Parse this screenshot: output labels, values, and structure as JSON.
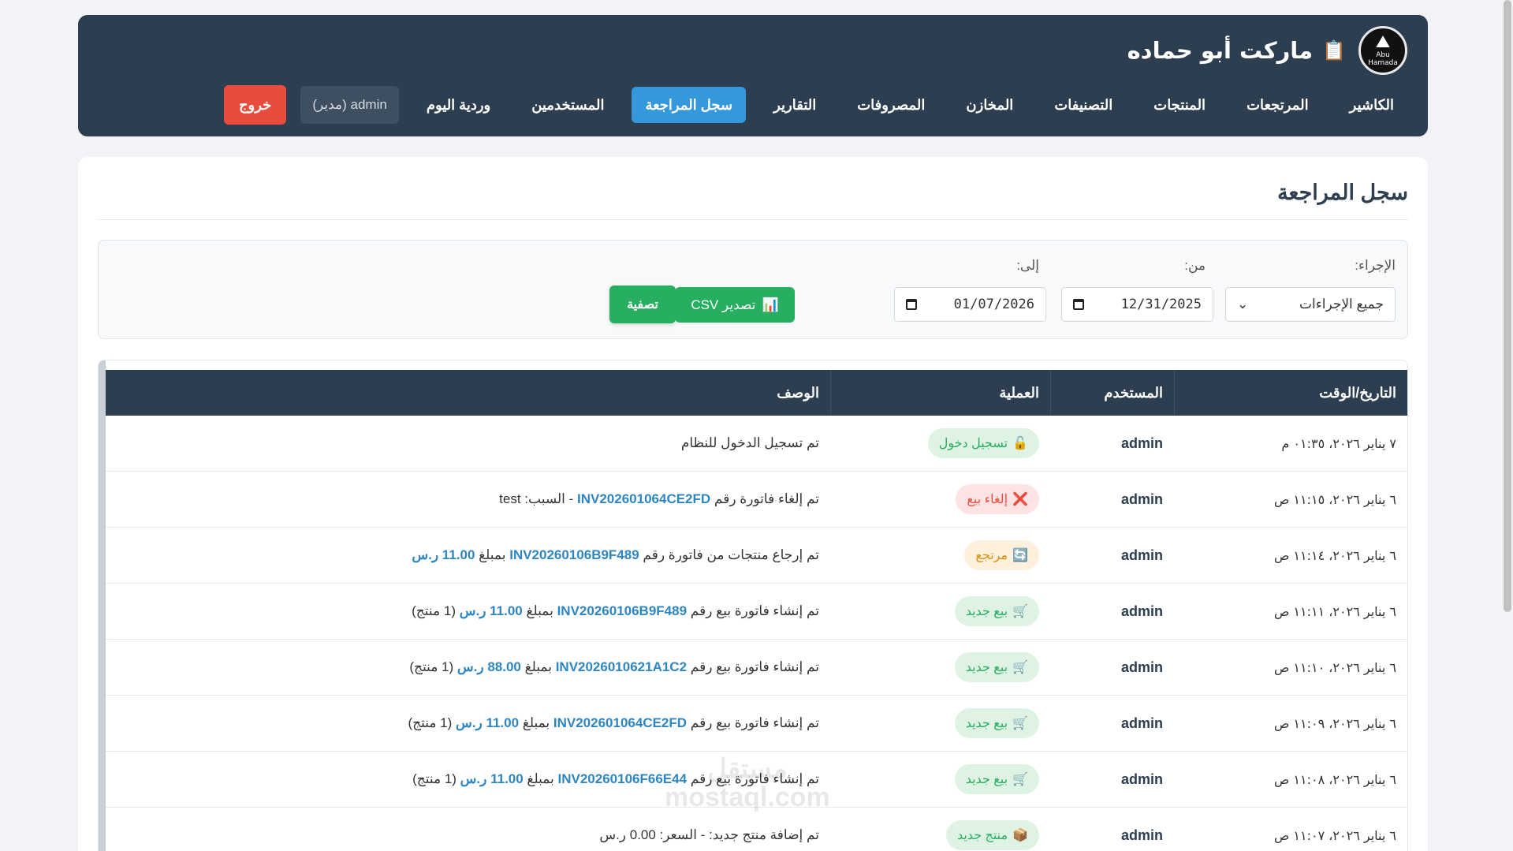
{
  "app": {
    "title": "ماركت أبو حماده",
    "logo_text": "Abu Hamada"
  },
  "nav": {
    "items": [
      {
        "label": "الكاشير"
      },
      {
        "label": "المرتجعات"
      },
      {
        "label": "المنتجات"
      },
      {
        "label": "التصنيفات"
      },
      {
        "label": "المخازن"
      },
      {
        "label": "المصروفات"
      },
      {
        "label": "التقارير"
      },
      {
        "label": "سجل المراجعة",
        "active": true
      },
      {
        "label": "المستخدمين"
      },
      {
        "label": "وردية اليوم"
      }
    ],
    "user_label": "admin (مدير)",
    "logout_label": "خروج"
  },
  "page": {
    "title": "سجل المراجعة"
  },
  "filters": {
    "action_label": "الإجراء:",
    "action_value": "جميع الإجراءات",
    "from_label": "من:",
    "from_value": "12/31/2025",
    "to_label": "إلى:",
    "to_value": "01/07/2026",
    "filter_button": "تصفية",
    "export_button": "تصدير CSV"
  },
  "table": {
    "headers": [
      "التاريخ/الوقت",
      "المستخدم",
      "العملية",
      "الوصف"
    ],
    "rows": [
      {
        "datetime": "٧ يناير ٢٠٢٦، ٠١:٣٥ م",
        "user": "admin",
        "action": "تسجيل دخول",
        "action_icon": "🔓",
        "type": "login",
        "desc": [
          {
            "t": "تم تسجيل الدخول للنظام"
          }
        ]
      },
      {
        "datetime": "٦ يناير ٢٠٢٦، ١١:١٥ ص",
        "user": "admin",
        "action": "إلغاء بيع",
        "action_icon": "❌",
        "type": "cancel",
        "desc": [
          {
            "t": "تم إلغاء فاتورة رقم "
          },
          {
            "t": "INV202601064CE2FD",
            "hl": true
          },
          {
            "t": " - السبب: test"
          }
        ]
      },
      {
        "datetime": "٦ يناير ٢٠٢٦، ١١:١٤ ص",
        "user": "admin",
        "action": "مرتجع",
        "action_icon": "🔄",
        "type": "return",
        "desc": [
          {
            "t": "تم إرجاع منتجات من فاتورة رقم "
          },
          {
            "t": "INV20260106B9F489",
            "hl": true
          },
          {
            "t": " بمبلغ "
          },
          {
            "t": "11.00 ر.س",
            "hl": true
          }
        ]
      },
      {
        "datetime": "٦ يناير ٢٠٢٦، ١١:١١ ص",
        "user": "admin",
        "action": "بيع جديد",
        "action_icon": "🛒",
        "type": "sale",
        "desc": [
          {
            "t": "تم إنشاء فاتورة بيع رقم "
          },
          {
            "t": "INV20260106B9F489",
            "hl": true
          },
          {
            "t": " بمبلغ "
          },
          {
            "t": "11.00 ر.س",
            "hl": true
          },
          {
            "t": " (1 منتج)"
          }
        ]
      },
      {
        "datetime": "٦ يناير ٢٠٢٦، ١١:١٠ ص",
        "user": "admin",
        "action": "بيع جديد",
        "action_icon": "🛒",
        "type": "sale",
        "desc": [
          {
            "t": "تم إنشاء فاتورة بيع رقم "
          },
          {
            "t": "INV2026010621A1C2",
            "hl": true
          },
          {
            "t": " بمبلغ "
          },
          {
            "t": "88.00 ر.س",
            "hl": true
          },
          {
            "t": " (1 منتج)"
          }
        ]
      },
      {
        "datetime": "٦ يناير ٢٠٢٦، ١١:٠٩ ص",
        "user": "admin",
        "action": "بيع جديد",
        "action_icon": "🛒",
        "type": "sale",
        "desc": [
          {
            "t": "تم إنشاء فاتورة بيع رقم "
          },
          {
            "t": "INV202601064CE2FD",
            "hl": true
          },
          {
            "t": " بمبلغ "
          },
          {
            "t": "11.00 ر.س",
            "hl": true
          },
          {
            "t": " (1 منتج)"
          }
        ]
      },
      {
        "datetime": "٦ يناير ٢٠٢٦، ١١:٠٨ ص",
        "user": "admin",
        "action": "بيع جديد",
        "action_icon": "🛒",
        "type": "sale",
        "desc": [
          {
            "t": "تم إنشاء فاتورة بيع رقم "
          },
          {
            "t": "INV20260106F66E44",
            "hl": true
          },
          {
            "t": " بمبلغ "
          },
          {
            "t": "11.00 ر.س",
            "hl": true
          },
          {
            "t": " (1 منتج)"
          }
        ]
      },
      {
        "datetime": "٦ يناير ٢٠٢٦، ١١:٠٧ ص",
        "user": "admin",
        "action": "منتج جديد",
        "action_icon": "📦",
        "type": "product",
        "desc": [
          {
            "t": "تم إضافة منتج جديد: - السعر: 0.00 ر.س"
          }
        ]
      }
    ]
  },
  "watermark": {
    "line1": "مستقل",
    "line2": "mostaql.com"
  },
  "colors": {
    "header_bg": "#2c3e50",
    "accent": "#3498db",
    "success": "#27ae60",
    "danger": "#e74c3c",
    "warning": "#e08e0b",
    "link": "#2e86c1"
  }
}
